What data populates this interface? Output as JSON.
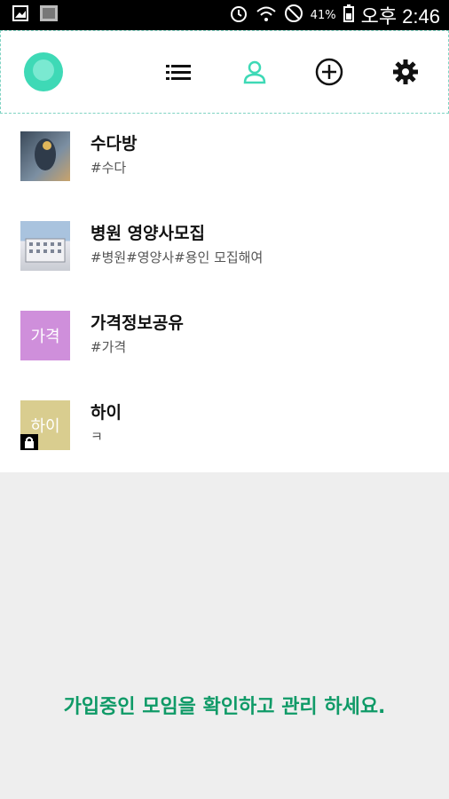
{
  "status_bar": {
    "battery": "41%",
    "time": "오후 2:46"
  },
  "toolbar": {
    "icons": [
      "logo-bubble-icon",
      "list-icon",
      "person-icon",
      "add-circle-icon",
      "gear-icon"
    ],
    "accent": "#3ed9b6"
  },
  "groups": [
    {
      "title": "수다방",
      "tags": "#수다",
      "thumb_text": "",
      "thumb_color": "#5a6b7a"
    },
    {
      "title": "병원 영양사모집",
      "tags": "#병원#영양사#용인 모집해여",
      "thumb_text": "",
      "thumb_color": "#9bb0c4"
    },
    {
      "title": "가격정보공유",
      "tags": "#가격",
      "thumb_text": "가격",
      "thumb_color": "#cf8fdb"
    },
    {
      "title": "하이",
      "tags": "ㅋ",
      "thumb_text": "하이",
      "thumb_color": "#d9cd8f",
      "locked": true
    }
  ],
  "footer_message": "가입중인 모임을 확인하고 관리 하세요.",
  "colors": {
    "message": "#0f9a67",
    "background": "#eeeeee"
  }
}
